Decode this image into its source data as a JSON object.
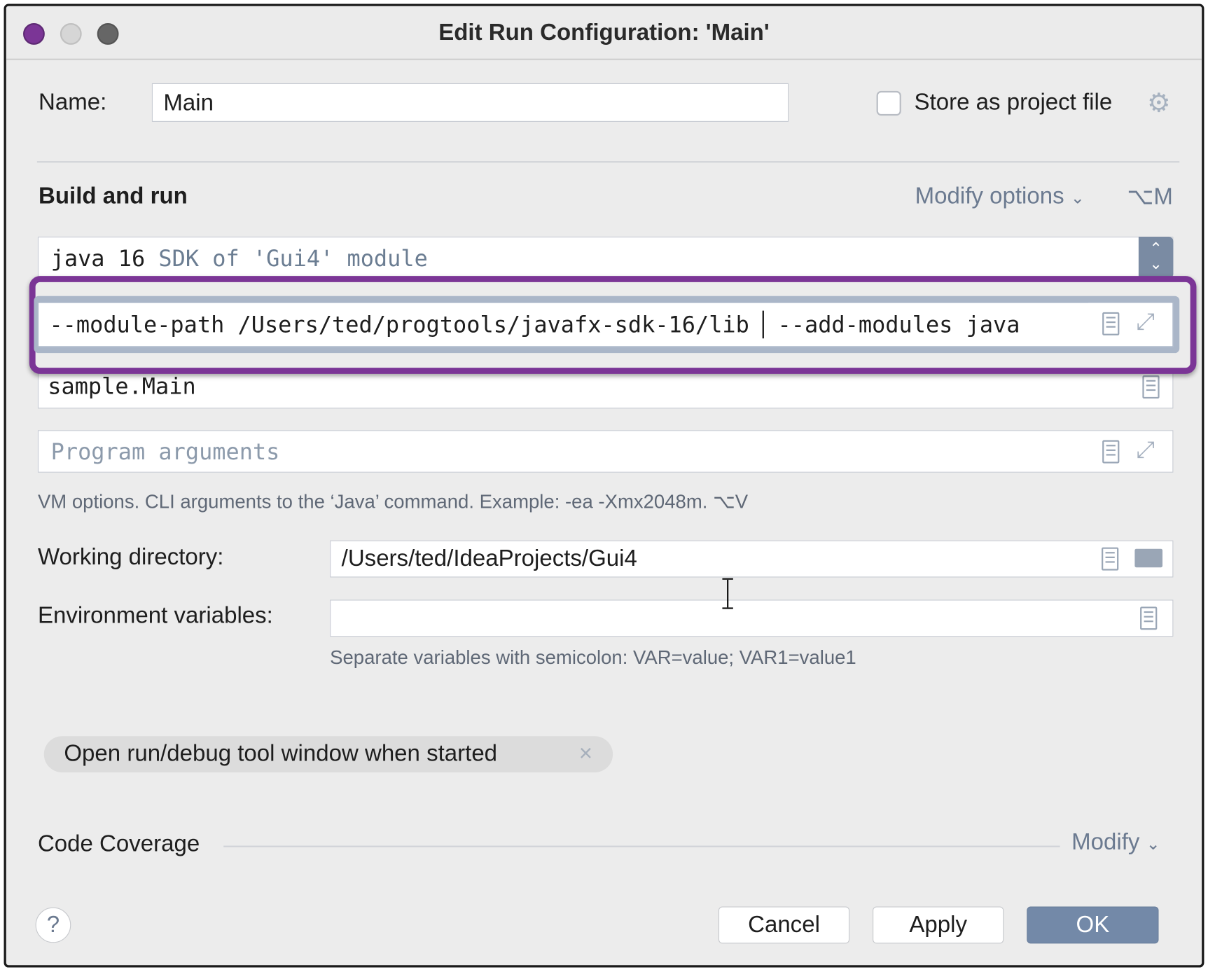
{
  "window": {
    "title": "Edit Run Configuration: 'Main'"
  },
  "name_row": {
    "label": "Name:",
    "value": "Main",
    "store_label": "Store as project file",
    "store_checked": false
  },
  "section": {
    "title": "Build and run",
    "modify_options": "Modify options",
    "modify_shortcut": "⌥M"
  },
  "jre": {
    "value": "java 16",
    "hint": "SDK of 'Gui4' module"
  },
  "vm_options": {
    "value_before_caret": "--module-path /Users/ted/progtools/javafx-sdk-16/lib",
    "value_after_caret": "--add-modules java"
  },
  "main_class": {
    "value": "sample.Main"
  },
  "program_args": {
    "placeholder": "Program arguments"
  },
  "vm_hint": "VM options. CLI arguments to the ‘Java’ command. Example: -ea -Xmx2048m. ⌥V",
  "working_dir": {
    "label": "Working directory:",
    "value": "/Users/ted/IdeaProjects/Gui4"
  },
  "env_vars": {
    "label": "Environment variables:",
    "value": "",
    "hint": "Separate variables with semicolon: VAR=value; VAR1=value1"
  },
  "chip": {
    "label": "Open run/debug tool window when started",
    "close": "×"
  },
  "code_coverage": {
    "label": "Code Coverage",
    "modify": "Modify"
  },
  "buttons": {
    "help": "?",
    "cancel": "Cancel",
    "apply": "Apply",
    "ok": "OK"
  },
  "colors": {
    "highlight": "#7b3596",
    "accent": "#7389a8",
    "link": "#6b7a90"
  }
}
